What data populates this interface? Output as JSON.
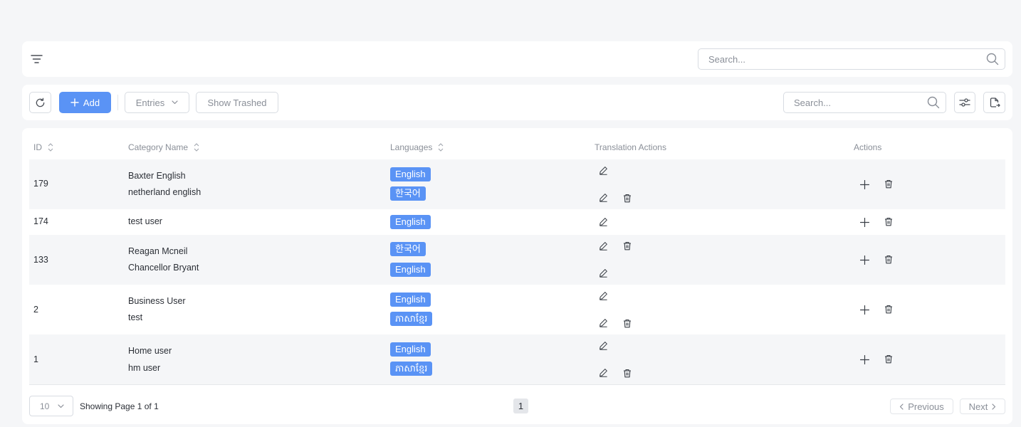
{
  "filter_bar": {
    "search_placeholder": "Search..."
  },
  "toolbar": {
    "add_label": "Add",
    "entries_label": "Entries",
    "show_trashed_label": "Show Trashed",
    "search_placeholder": "Search..."
  },
  "table": {
    "headers": {
      "id": "ID",
      "category_name": "Category Name",
      "languages": "Languages",
      "translation_actions": "Translation Actions",
      "actions": "Actions"
    },
    "rows": [
      {
        "id": "179",
        "names": [
          "Baxter English",
          "netherland english"
        ],
        "languages": [
          "English",
          "한국어"
        ]
      },
      {
        "id": "174",
        "names": [
          "test user"
        ],
        "languages": [
          "English"
        ]
      },
      {
        "id": "133",
        "names": [
          "Reagan Mcneil",
          "Chancellor Bryant"
        ],
        "languages": [
          "한국어",
          "English"
        ]
      },
      {
        "id": "2",
        "names": [
          "Business User",
          "test"
        ],
        "languages": [
          "English",
          "ភាសាខ្មែរ"
        ]
      },
      {
        "id": "1",
        "names": [
          "Home user",
          "hm user"
        ],
        "languages": [
          "English",
          "ភាសាខ្មែរ"
        ]
      }
    ]
  },
  "footer": {
    "page_size": "10",
    "showing_text": "Showing Page 1 of 1",
    "current_page": "1",
    "previous_label": "Previous",
    "next_label": "Next"
  },
  "colors": {
    "accent": "#5a93f5",
    "background": "#f5f6f8",
    "row_stripe": "#f5f6f8"
  },
  "icons": {
    "filter": "filter-lines-icon",
    "search": "search-icon",
    "refresh": "refresh-icon",
    "plus": "plus-icon",
    "chevron": "chevron-down-icon",
    "settings": "sliders-icon",
    "export": "export-file-icon",
    "edit": "edit-icon",
    "delete": "trash-icon",
    "sort": "sort-icon"
  }
}
